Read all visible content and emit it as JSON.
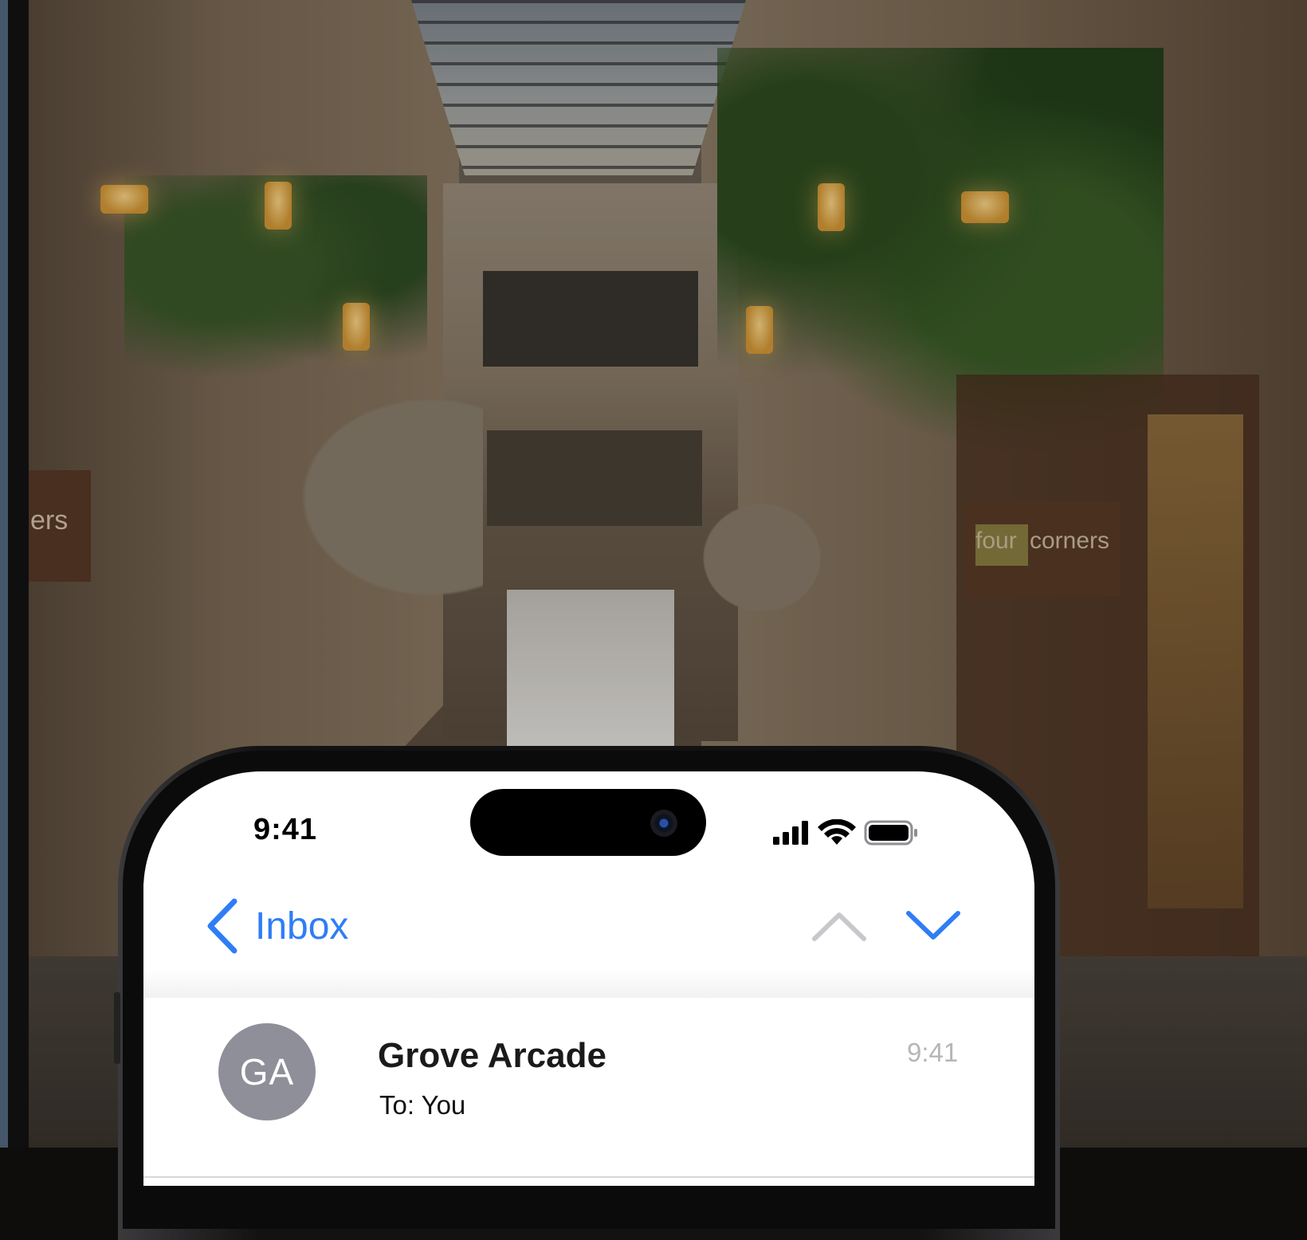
{
  "background": {
    "sign_left_text": "ers",
    "sign_right_text_a": "four",
    "sign_right_text_b": "corners"
  },
  "status_bar": {
    "time": "9:41"
  },
  "nav": {
    "back_label": "Inbox",
    "back_icon": "chevron-left-icon",
    "prev_icon": "chevron-up-icon",
    "next_icon": "chevron-down-icon",
    "accent_color": "#2f7df6",
    "disabled_color": "#c7c7cc"
  },
  "message": {
    "avatar_initials": "GA",
    "avatar_color": "#8e8f99",
    "sender": "Grove Arcade",
    "to_line": "To: You",
    "time": "9:41"
  }
}
